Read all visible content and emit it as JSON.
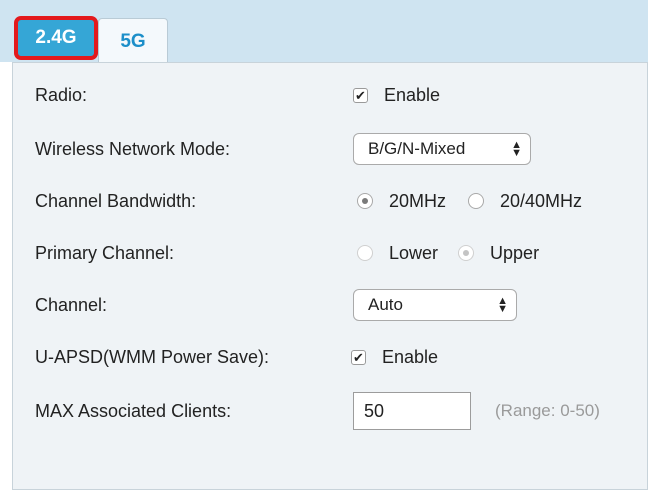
{
  "tabs": [
    {
      "label": "2.4G",
      "active": true
    },
    {
      "label": "5G",
      "active": false
    }
  ],
  "colors": {
    "active_tab_bg": "#35a6d6",
    "highlight_border": "#e3191c",
    "inactive_tab_text": "#1c8fc9",
    "panel_bg": "#eff3f6",
    "header_bg": "#cfe4f1"
  },
  "form": {
    "radio": {
      "label": "Radio:",
      "checked": true,
      "option": "Enable"
    },
    "wireless_mode": {
      "label": "Wireless Network Mode:",
      "value": "B/G/N-Mixed",
      "icon": "updown-arrows-icon"
    },
    "channel_bandwidth": {
      "label": "Channel Bandwidth:",
      "opt1": "20MHz",
      "opt2": "20/40MHz",
      "selected": "20MHz"
    },
    "primary_channel": {
      "label": "Primary Channel:",
      "opt1": "Lower",
      "opt2": "Upper",
      "selected": "Upper",
      "disabled": true
    },
    "channel": {
      "label": "Channel:",
      "value": "Auto",
      "icon": "updown-arrows-icon"
    },
    "uapsd": {
      "label": "U-APSD(WMM Power Save):",
      "checked": true,
      "option": "Enable"
    },
    "max_clients": {
      "label": "MAX Associated Clients:",
      "value": "50",
      "hint": "(Range: 0-50)"
    }
  }
}
